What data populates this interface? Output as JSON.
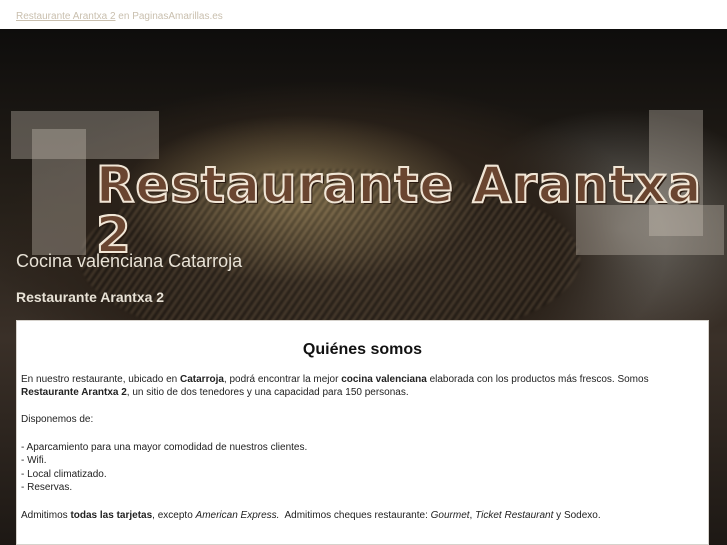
{
  "topbar": {
    "link_text": "Restaurante Arantxa 2",
    "suffix": " en PaginasAmarillas.es"
  },
  "hero": {
    "logo_text": "Restaurante Arantxa 2",
    "subtitle": "Cocina valenciana Catarroja",
    "name": "Restaurante Arantxa 2"
  },
  "about": {
    "heading": "Quiénes somos",
    "p1": {
      "t1": "En nuestro restaurante, ubicado en ",
      "b1": "Catarroja",
      "t2": ", podrá encontrar la mejor ",
      "b2": "cocina valenciana",
      "t3": " elaborada con los productos más frescos. Somos ",
      "b3": "Restaurante Arantxa 2",
      "t4": ", un sitio de dos tenedores y una capacidad para 150 personas."
    },
    "p2": "Disponemos de:",
    "list": [
      "- Aparcamiento para una mayor comodidad de nuestros clientes.",
      "- Wifi.",
      "- Local climatizado.",
      "- Reservas."
    ],
    "p3": {
      "t1": "Admitimos ",
      "b1": "todas las tarjetas",
      "t2": ", excepto ",
      "i1": "American Express.",
      "t3": "  Admitimos cheques restaurante: ",
      "i2": "Gourmet",
      "t4": ", ",
      "i3": "Ticket Restaurant",
      "t5": " y Sodexo."
    }
  }
}
